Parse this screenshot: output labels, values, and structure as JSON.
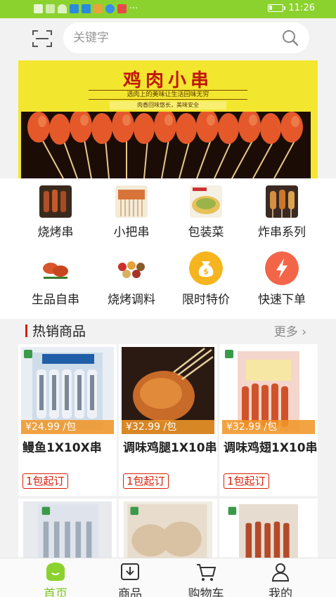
{
  "status_bar": {
    "time": "11:26",
    "dots": "···"
  },
  "search": {
    "placeholder": "关键字"
  },
  "banner": {
    "title": "鸡肉小串",
    "subtitle": "选肉上的美味让生活回味无穷",
    "tagline": "肉香回味悠长，美味安全"
  },
  "categories": [
    {
      "label": "烧烤串",
      "icon": "bbq-skewer-photo"
    },
    {
      "label": "小把串",
      "icon": "small-skewer-photo"
    },
    {
      "label": "包装菜",
      "icon": "packaged-dish-photo"
    },
    {
      "label": "炸串系列",
      "icon": "fried-skewer-photo"
    },
    {
      "label": "生品自串",
      "icon": "raw-meat-photo"
    },
    {
      "label": "烧烤调料",
      "icon": "seasoning-photo"
    },
    {
      "label": "限时特价",
      "icon": "money-bag-icon"
    },
    {
      "label": "快速下单",
      "icon": "lightning-icon"
    }
  ],
  "hot": {
    "title": "热销商品",
    "more": "更多"
  },
  "products": [
    {
      "price": "¥24.99 /包",
      "name": "鳗鱼1X10X串",
      "moq": "1包起订"
    },
    {
      "price": "¥32.99 /包",
      "name": "调味鸡腿1X10串",
      "moq": "1包起订"
    },
    {
      "price": "¥32.99 /包",
      "name": "调味鸡翅1X10串",
      "moq": "1包起订"
    }
  ],
  "nav": [
    {
      "label": "首页",
      "icon": "home-icon"
    },
    {
      "label": "商品",
      "icon": "download-box-icon"
    },
    {
      "label": "购物车",
      "icon": "cart-icon"
    },
    {
      "label": "我的",
      "icon": "user-icon"
    }
  ],
  "colors": {
    "accent": "#8bd22f",
    "price_tag": "#f0962a",
    "red": "#d81e06"
  }
}
